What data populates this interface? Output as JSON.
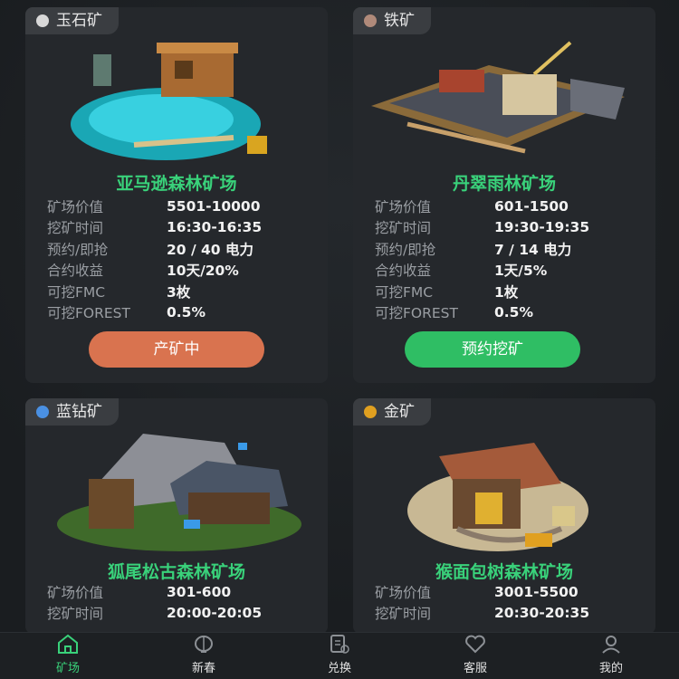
{
  "cards": [
    {
      "tag": "玉石矿",
      "gem_color": "#d8d8d8",
      "title": "亚马逊森林矿场",
      "rows": [
        {
          "label": "矿场价值",
          "value": "5501-10000"
        },
        {
          "label": "挖矿时间",
          "value": "16:30-16:35"
        },
        {
          "label": "预约/即抢",
          "value": "20 / 40 电力"
        },
        {
          "label": "合约收益",
          "value": "10天/20%"
        },
        {
          "label": "可挖FMC",
          "value": "3枚"
        },
        {
          "label": "可挖FOREST",
          "value": "0.5%"
        }
      ],
      "button": "产矿中",
      "button_color": "#d9734f"
    },
    {
      "tag": "铁矿",
      "gem_color": "#b08a7a",
      "title": "丹翠雨林矿场",
      "rows": [
        {
          "label": "矿场价值",
          "value": "601-1500"
        },
        {
          "label": "挖矿时间",
          "value": "19:30-19:35"
        },
        {
          "label": "预约/即抢",
          "value": "7 / 14 电力"
        },
        {
          "label": "合约收益",
          "value": "1天/5%"
        },
        {
          "label": "可挖FMC",
          "value": "1枚"
        },
        {
          "label": "可挖FOREST",
          "value": "0.5%"
        }
      ],
      "button": "预约挖矿",
      "button_color": "#2fbe64"
    },
    {
      "tag": "蓝钻矿",
      "gem_color": "#4a90e2",
      "title": "狐尾松古森林矿场",
      "rows": [
        {
          "label": "矿场价值",
          "value": "301-600"
        },
        {
          "label": "挖矿时间",
          "value": "20:00-20:05"
        }
      ]
    },
    {
      "tag": "金矿",
      "gem_color": "#e0a020",
      "title": "猴面包树森林矿场",
      "rows": [
        {
          "label": "矿场价值",
          "value": "3001-5500"
        },
        {
          "label": "挖矿时间",
          "value": "20:30-20:35"
        }
      ]
    }
  ],
  "tabbar": {
    "tabs": [
      {
        "label": "矿场",
        "icon": "home-icon",
        "active": true
      },
      {
        "label": "新春",
        "icon": "lantern-icon",
        "active": false
      },
      {
        "label": "兑换",
        "icon": "exchange-icon",
        "active": false
      },
      {
        "label": "客服",
        "icon": "heart-icon",
        "active": false
      },
      {
        "label": "我的",
        "icon": "user-icon",
        "active": false
      }
    ]
  },
  "colors": {
    "accent": "#39d17a",
    "orange_button": "#d9734f",
    "green_button": "#2fbe64"
  }
}
